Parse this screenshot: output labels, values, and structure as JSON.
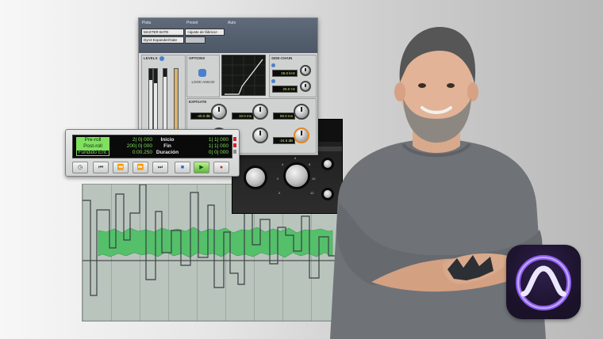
{
  "plugin": {
    "header": {
      "pista_label": "Pista",
      "preset_label": "Preset",
      "auto_label": "Auto",
      "track_name": "MASTER BATE",
      "plugin_name": "Dyn3 Expander/Gate",
      "preset_value": "<ajuste de fábrica>"
    },
    "panels": {
      "levels": "LEVELS",
      "options": "OPTIONS",
      "sidechain": "SIDE-CHAIN",
      "expgate": "EXP/GATE",
      "look_ahead": "LOOK AHEAD"
    },
    "readouts": {
      "sc_freq_1": "25.0 kHz",
      "sc_freq_2": "20.0 Hz",
      "threshold": "-40.0 dB",
      "attack": "10.0 ms",
      "hold": "50.0 ms",
      "range": "-24.6 dB"
    }
  },
  "transport": {
    "rows": [
      {
        "label": "Pre-roll",
        "value": "2| 0| 000",
        "field": "Inicio",
        "time": "1| 1| 000",
        "active": true
      },
      {
        "label": "Post-roll",
        "value": "200| 0| 000",
        "field": "Fin",
        "time": "1| 1| 000",
        "active": true
      },
      {
        "label": "Fundido Ent.",
        "value": "0:00.250",
        "field": "Duración",
        "time": "0| 0| 000",
        "active": false
      }
    ],
    "buttons": [
      {
        "name": "online-button",
        "icon": "clock-icon",
        "glyph": "◷"
      },
      {
        "name": "return-to-zero-button",
        "icon": "return-to-zero-icon",
        "glyph": "⏮"
      },
      {
        "name": "rewind-button",
        "icon": "rewind-icon",
        "glyph": "⏪"
      },
      {
        "name": "fast-forward-button",
        "icon": "fast-forward-icon",
        "glyph": "⏩"
      },
      {
        "name": "go-to-end-button",
        "icon": "go-to-end-icon",
        "glyph": "⏭"
      },
      {
        "name": "stop-button",
        "icon": "stop-icon",
        "glyph": "■"
      },
      {
        "name": "play-button",
        "icon": "play-icon",
        "glyph": "▶"
      },
      {
        "name": "record-button",
        "icon": "record-icon",
        "glyph": "●"
      }
    ]
  },
  "hardware_plugin": {
    "scale_ticks": [
      "0",
      "2",
      "4",
      "6",
      "8",
      "10",
      "12"
    ]
  },
  "app_icon": {
    "name": "pro-tools-icon",
    "colors": {
      "ring_outer": "#8e5cf0",
      "ring_inner": "#e6ddff"
    }
  },
  "colors": {
    "counter_green": "#7fe05e",
    "waveform": "#54c06a",
    "automation": "#3b3f44"
  }
}
